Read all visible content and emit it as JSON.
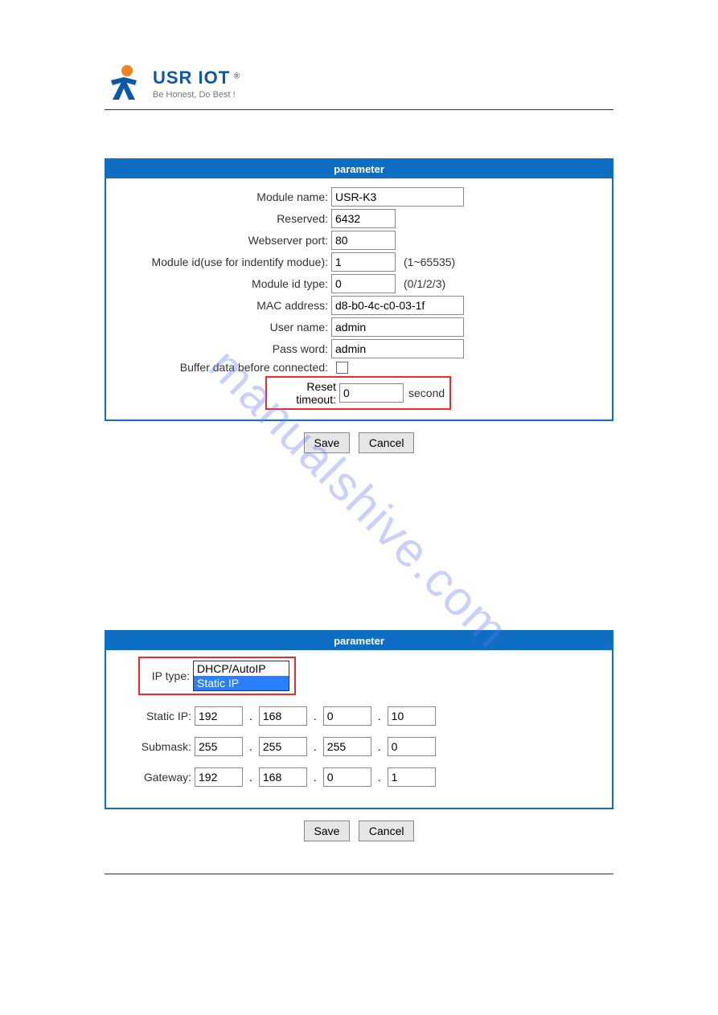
{
  "logo": {
    "title": "USR IOT",
    "subtitle": "Be Honest, Do Best !",
    "reg": "®"
  },
  "watermark": "manualshive.com",
  "panel1": {
    "title": "parameter",
    "rows": {
      "module_name": {
        "label": "Module name:",
        "value": "USR-K3"
      },
      "reserved": {
        "label": "Reserved:",
        "value": "6432"
      },
      "webserver_port": {
        "label": "Webserver port:",
        "value": "80"
      },
      "module_id": {
        "label": "Module id(use for indentify modue):",
        "value": "1",
        "hint": "(1~65535)"
      },
      "module_id_type": {
        "label": "Module id type:",
        "value": "0",
        "hint": "(0/1/2/3)"
      },
      "mac": {
        "label": "MAC address:",
        "value": "d8-b0-4c-c0-03-1f"
      },
      "user": {
        "label": "User name:",
        "value": "admin"
      },
      "pass": {
        "label": "Pass word:",
        "value": "admin"
      },
      "buffer": {
        "label": "Buffer data before connected:"
      },
      "reset": {
        "label": "Reset timeout:",
        "value": "0",
        "unit": "second"
      }
    },
    "save": "Save",
    "cancel": "Cancel"
  },
  "panel2": {
    "title": "parameter",
    "ip_type": {
      "label": "IP type:",
      "options": [
        "DHCP/AutoIP",
        "Static IP"
      ],
      "selected": "Static IP"
    },
    "static_ip": {
      "label": "Static IP:",
      "a": "192",
      "b": "168",
      "c": "0",
      "d": "10"
    },
    "submask": {
      "label": "Submask:",
      "a": "255",
      "b": "255",
      "c": "255",
      "d": "0"
    },
    "gateway": {
      "label": "Gateway:",
      "a": "192",
      "b": "168",
      "c": "0",
      "d": "1"
    },
    "save": "Save",
    "cancel": "Cancel"
  }
}
